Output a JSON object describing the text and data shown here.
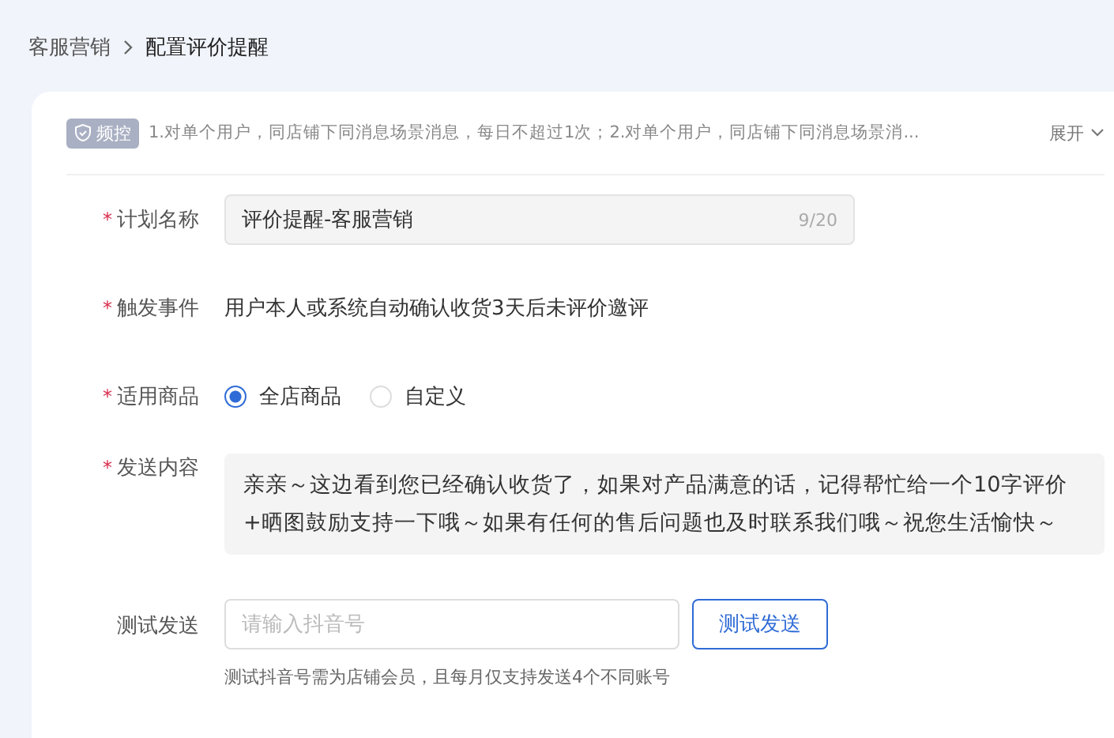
{
  "breadcrumb": [
    {
      "label": "客服营销",
      "current": false
    },
    {
      "label": "配置评价提醒",
      "current": true
    }
  ],
  "notice": {
    "badge": "频控",
    "text": "1.对单个用户，同店铺下同消息场景消息，每日不超过1次；2.对单个用户，同店铺下同消息场景消...",
    "toggle": "展开"
  },
  "form": [
    {
      "kind": "input",
      "label": "计划名称",
      "required_mark": "*",
      "value": "评价提醒-客服营销",
      "counter": "9/20"
    },
    {
      "kind": "text",
      "label": "触发事件",
      "required_mark": "*",
      "value": "用户本人或系统自动确认收货3天后未评价邀评"
    },
    {
      "kind": "radio",
      "label": "适用商品",
      "required_mark": "*",
      "options": [
        {
          "label": "全店商品",
          "selected": true
        },
        {
          "label": "自定义",
          "selected": false
        }
      ]
    },
    {
      "kind": "textarea",
      "label": "发送内容",
      "required_mark": "*",
      "value": "亲亲～这边看到您已经确认收货了，如果对产品满意的话，记得帮忙给一个10字评价+晒图鼓励支持一下哦～如果有任何的售后问题也及时联系我们哦～祝您生活愉快～"
    },
    {
      "kind": "test",
      "label": "测试发送",
      "placeholder": "请输入抖音号",
      "button": "测试发送",
      "hint": "测试抖音号需为店铺会员，且每月仅支持发送4个不同账号"
    }
  ]
}
